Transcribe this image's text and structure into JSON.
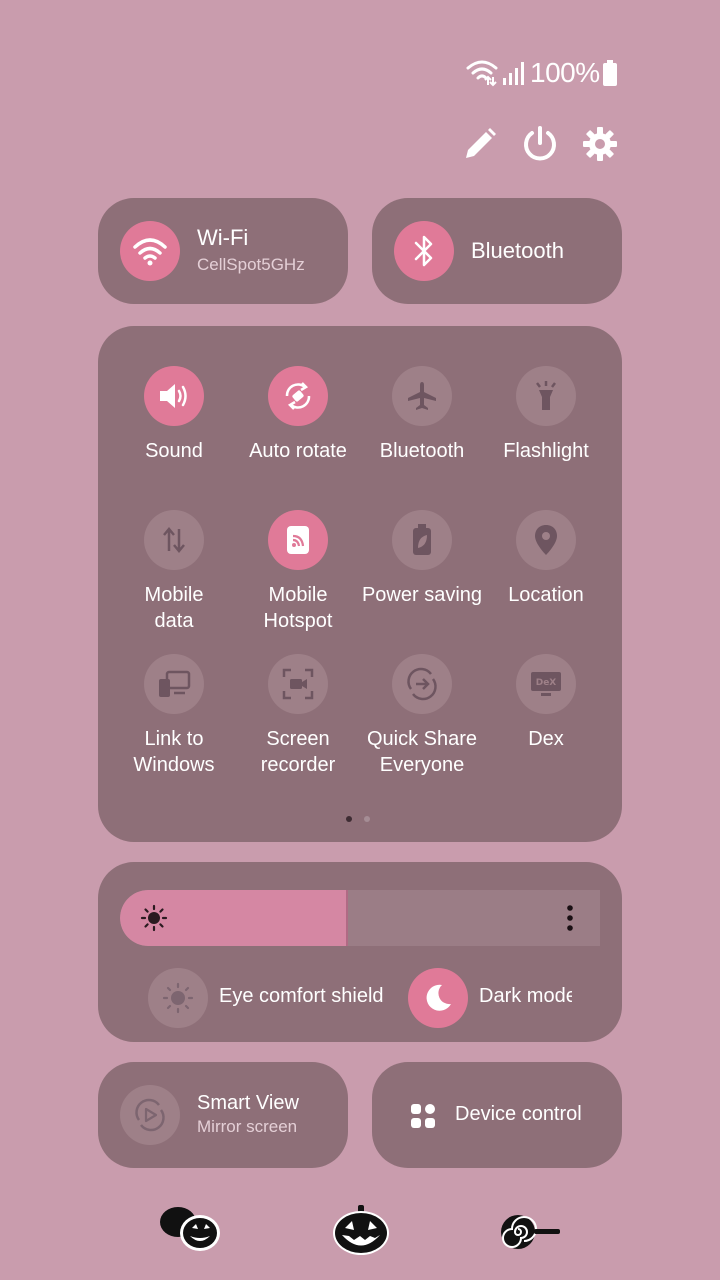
{
  "status": {
    "battery": "100%"
  },
  "top_actions": [
    {
      "icon": "pencil-icon"
    },
    {
      "icon": "power-icon"
    },
    {
      "icon": "gear-icon"
    }
  ],
  "wifi": {
    "title": "Wi-Fi",
    "subtitle": "CellSpot5GHz",
    "on": true
  },
  "bluetooth_big": {
    "title": "Bluetooth",
    "on": true
  },
  "tiles": [
    {
      "label": "Sound",
      "on": true
    },
    {
      "label": "Auto rotate",
      "on": true
    },
    {
      "label": "Bluetooth",
      "on": false
    },
    {
      "label": "Flashlight",
      "on": false
    },
    {
      "label": "Mobile\ndata",
      "on": false
    },
    {
      "label": "Mobile\nHotspot",
      "on": true
    },
    {
      "label": "Power saving",
      "on": false
    },
    {
      "label": "Location",
      "on": false
    },
    {
      "label": "Link to\nWindows",
      "on": false
    },
    {
      "label": "Screen\nrecorder",
      "on": false
    },
    {
      "label": "Quick Share\nEveryone",
      "on": false
    },
    {
      "label": "Dex",
      "on": false
    }
  ],
  "pager": {
    "pages": 2,
    "current": 1
  },
  "brightness": {
    "level": 0.47
  },
  "eye_comfort": {
    "label": "Eye comfort shield",
    "on": false
  },
  "dark_mode": {
    "label": "Dark mode",
    "on": true
  },
  "smart_view": {
    "title": "Smart View",
    "subtitle": "Mirror screen"
  },
  "device_control": {
    "label": "Device control"
  },
  "colors": {
    "accent": "#e07a98",
    "card": "#8e6f78",
    "background": "#c99cad",
    "off": "#9e8088"
  }
}
